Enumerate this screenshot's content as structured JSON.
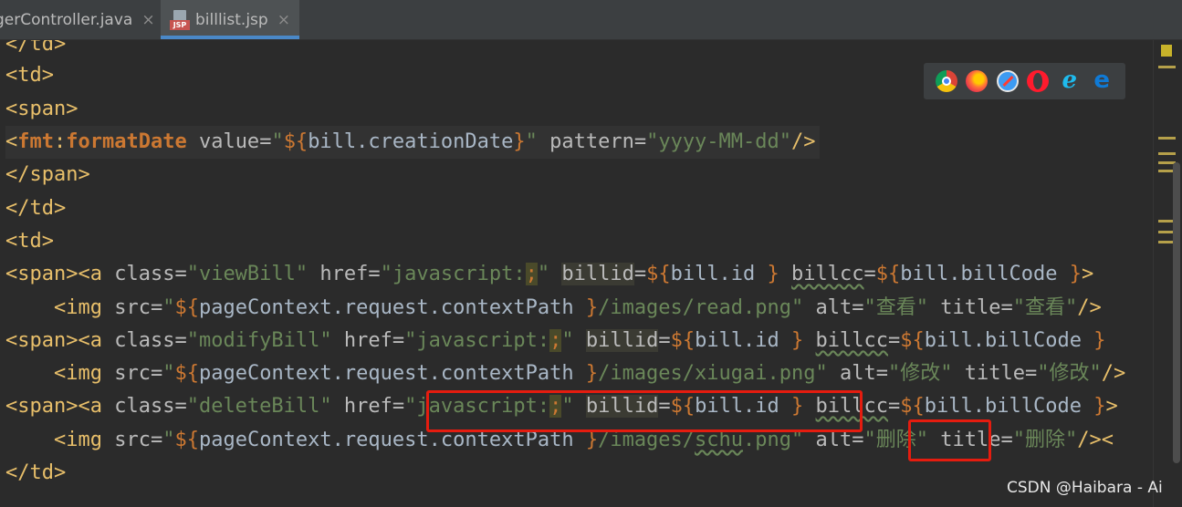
{
  "tabs": [
    {
      "label": "gerController.java",
      "active": false
    },
    {
      "label": "billlist.jsp",
      "active": true,
      "icon_badge": "JSP"
    }
  ],
  "close_glyph": "×",
  "code": {
    "l0": "</td>",
    "l1": "<td>",
    "l2": "<span>",
    "l3": {
      "open": "<",
      "prefix": "fmt",
      "colon": ":",
      "name": "formatDate",
      "sp1": " ",
      "attr1": "value",
      "eq1": "=",
      "q1": "\"",
      "expr_open": "${",
      "expr_var": "bill.creationDate",
      "expr_close": "}",
      "q2": "\"",
      "sp2": " ",
      "attr2": "pattern",
      "eq2": "=",
      "val2": "\"yyyy-MM-dd\"",
      "close": "/>"
    },
    "l4": "</span>",
    "l5": "</td>",
    "l6": "<td>",
    "view": {
      "tag": "<span><a",
      "sp": " ",
      "class_attr": "class",
      "eq": "=",
      "class_val": "\"viewBill\"",
      "href_attr": "href",
      "href_val": "\"javascript:",
      "semi": ";",
      "href_end": "\"",
      "billid_attr": "billid",
      "expr_open": "${",
      "id_var": "bill.id",
      "expr_close": " }",
      "billcc_attr": "billcc",
      "code_var": "bill.billCode",
      "code_close": " }",
      "end": ">"
    },
    "view_img": {
      "indent": "    ",
      "tag": "<img",
      "src_attr": "src",
      "q": "\"",
      "expr_open": "${",
      "ctx_var": "pageContext.request.contextPath",
      "expr_close": " }",
      "path": "/images/read.png\"",
      "alt_attr": "alt",
      "alt_val": "\"查看\"",
      "title_attr": "title",
      "title_val": "\"查看\"",
      "end": "/>"
    },
    "modify": {
      "tag": "<span><a",
      "class_val": "\"modifyBill\""
    },
    "modify_img": {
      "path": "/images/xiugai.png\"",
      "alt_val": "\"修改\"",
      "title_val": "\"修改\"",
      "end": "/>"
    },
    "delete": {
      "tag": "<span><a",
      "class_val": "\"deleteBill\""
    },
    "delete_img": {
      "path_a": "/images/",
      "path_b": "schu",
      "path_c": ".png\"",
      "alt_val": "\"删除\"",
      "title_val": "\"删除\"",
      "end": "/><"
    },
    "l15": "</td>"
  },
  "browser_icons": [
    "chrome-icon",
    "firefox-icon",
    "safari-icon",
    "opera-icon",
    "ie-icon",
    "edge-icon"
  ],
  "ie_glyph": "e",
  "edge_glyph": "e",
  "watermark": "CSDN @Haibara - Ai",
  "colors": {
    "highlight_box": "#e51c0f",
    "tab_underline": "#4a88c7",
    "string": "#6a8759",
    "keyword": "#cc7832",
    "tag": "#e8bf6a"
  }
}
